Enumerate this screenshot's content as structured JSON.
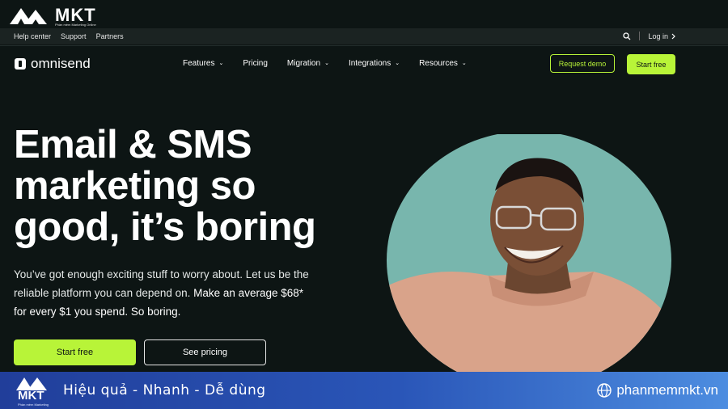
{
  "watermark": {
    "logo_text": "MKT",
    "tagline": "Phần mềm Marketing Online"
  },
  "utility": {
    "links": [
      "Help center",
      "Support",
      "Partners"
    ],
    "login_label": "Log in"
  },
  "nav": {
    "brand": "omnisend",
    "menu": [
      {
        "label": "Features",
        "dropdown": true
      },
      {
        "label": "Pricing",
        "dropdown": false
      },
      {
        "label": "Migration",
        "dropdown": true
      },
      {
        "label": "Integrations",
        "dropdown": true
      },
      {
        "label": "Resources",
        "dropdown": true
      }
    ],
    "request_demo_label": "Request demo",
    "start_free_label": "Start free"
  },
  "hero": {
    "headline_lines": [
      "Email & SMS",
      "marketing so",
      "good, it’s boring"
    ],
    "sub_part1": "You’ve got enough exciting stuff to worry about. Let us be the reliable platform you can depend on. ",
    "sub_part2": "Make an average $68* for every $1 you spend. So boring.",
    "cta_start": "Start free",
    "cta_pricing": "See pricing"
  },
  "banner": {
    "logo_text": "MKT",
    "logo_sub": "Phần mềm Marketing",
    "slogan": "Hiệu quả - Nhanh  - Dễ dùng",
    "site": "phanmemmkt.vn"
  },
  "colors": {
    "background": "#0d1514",
    "accent": "#b8f438",
    "photo_bg": "#78b6ad",
    "banner_start": "#213e9a",
    "banner_end": "#4d8de0"
  }
}
